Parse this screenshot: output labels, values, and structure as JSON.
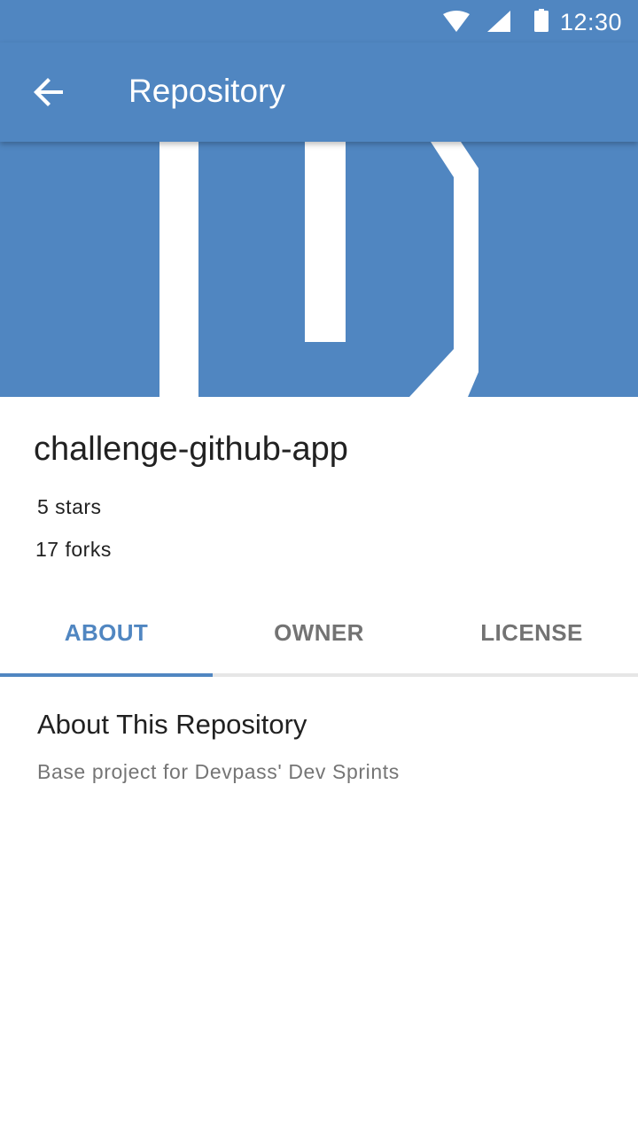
{
  "status_bar": {
    "time": "12:30",
    "icons": [
      "wifi-icon",
      "cell-signal-icon",
      "battery-icon"
    ]
  },
  "toolbar": {
    "title": "Repository",
    "back_icon": "arrow-left-icon"
  },
  "repository": {
    "name": "challenge-github-app",
    "stars": "5 stars",
    "forks": "17 forks"
  },
  "tabs": [
    {
      "label": "ABOUT",
      "active": true
    },
    {
      "label": "OWNER",
      "active": false
    },
    {
      "label": "LICENSE",
      "active": false
    }
  ],
  "about": {
    "title": "About This Repository",
    "description": "Base project for Devpass' Dev Sprints"
  },
  "colors": {
    "primary": "#5086c1",
    "text_primary": "#212121",
    "text_secondary": "#757575",
    "tab_inactive": "#737373"
  }
}
